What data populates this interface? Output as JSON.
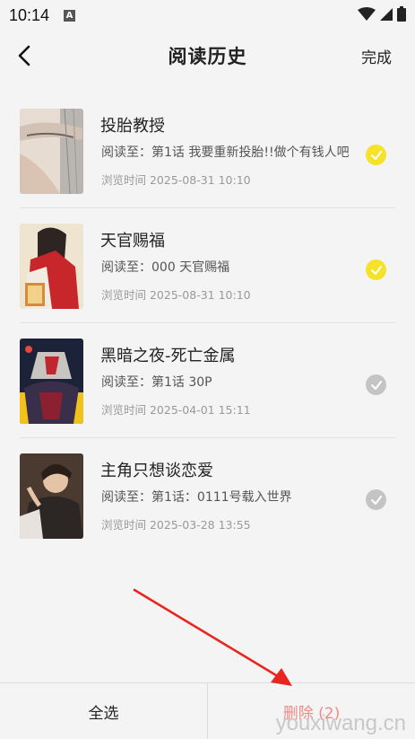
{
  "status_bar": {
    "time": "10:14",
    "badge": "A"
  },
  "header": {
    "title": "阅读历史",
    "done_label": "完成"
  },
  "items": [
    {
      "title": "投胎教授",
      "progress": "阅读至：第1话 我要重新投胎!!做个有钱人吧",
      "time": "浏览时间 2025-08-31 10:10",
      "checked": true
    },
    {
      "title": "天官赐福",
      "progress": "阅读至：000 天官赐福",
      "time": "浏览时间 2025-08-31 10:10",
      "checked": true
    },
    {
      "title": "黑暗之夜-死亡金属",
      "progress": "阅读至：第1话 30P",
      "time": "浏览时间 2025-04-01 15:11",
      "checked": false
    },
    {
      "title": "主角只想谈恋爱",
      "progress": "阅读至：第1话：0111号载入世界",
      "time": "浏览时间 2025-03-28 13:55",
      "checked": false
    }
  ],
  "bottom": {
    "select_all_label": "全选",
    "delete_label": "删除 (2)"
  },
  "watermark": "youxiwang.cn",
  "colors": {
    "checked": "#f6e228",
    "unchecked": "#c4c4c4",
    "delete_text": "#f08a86",
    "annotation_arrow": "#e8251f"
  }
}
